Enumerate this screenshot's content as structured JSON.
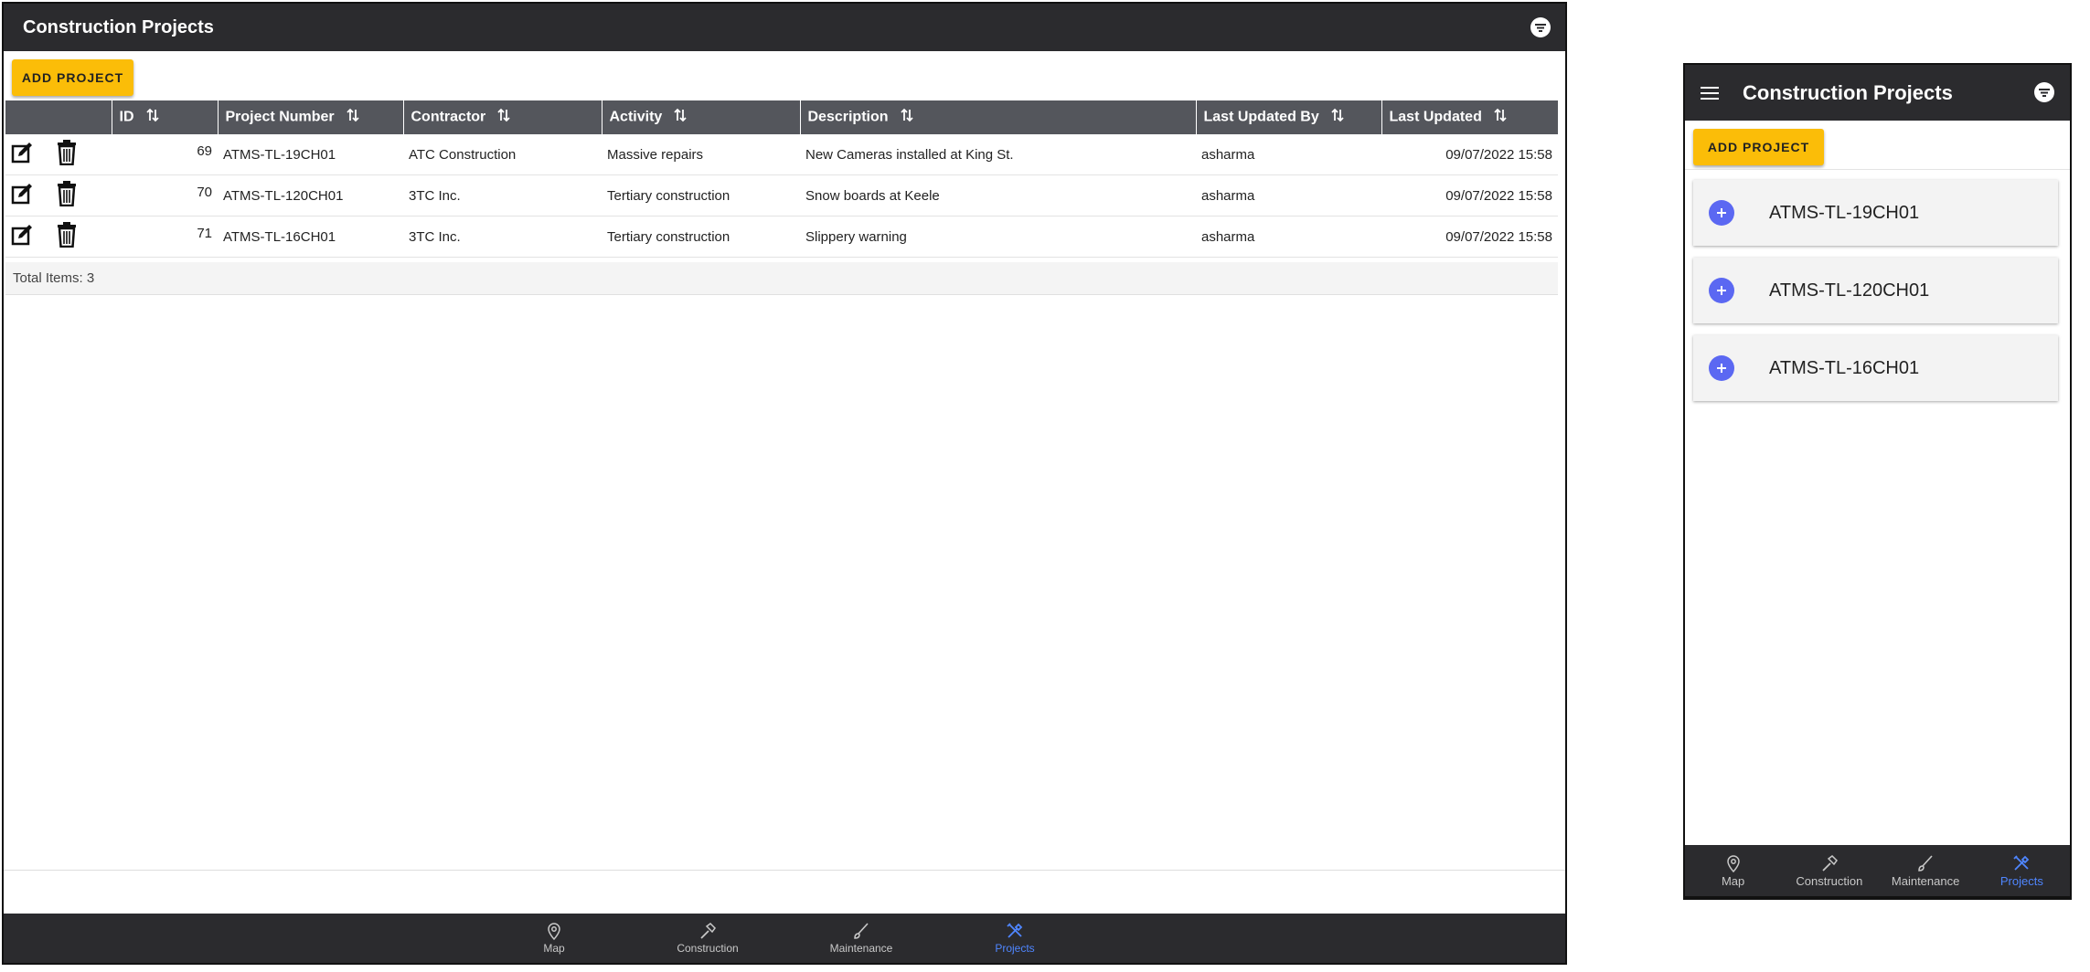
{
  "desktop": {
    "title": "Construction Projects",
    "add_button": "ADD PROJECT",
    "columns": [
      "ID",
      "Project Number",
      "Contractor",
      "Activity",
      "Description",
      "Last Updated By",
      "Last Updated"
    ],
    "rows": [
      {
        "id": "69",
        "project_number": "ATMS-TL-19CH01",
        "contractor": "ATC Construction",
        "activity": "Massive repairs",
        "description": "New Cameras installed at King St.",
        "updated_by": "asharma",
        "updated": "09/07/2022 15:58"
      },
      {
        "id": "70",
        "project_number": "ATMS-TL-120CH01",
        "contractor": "3TC Inc.",
        "activity": "Tertiary construction",
        "description": "Snow boards at Keele",
        "updated_by": "asharma",
        "updated": "09/07/2022 15:58"
      },
      {
        "id": "71",
        "project_number": "ATMS-TL-16CH01",
        "contractor": "3TC Inc.",
        "activity": "Tertiary construction",
        "description": "Slippery warning",
        "updated_by": "asharma",
        "updated": "09/07/2022 15:58"
      }
    ],
    "total_items": "Total Items: 3"
  },
  "nav": {
    "items": [
      {
        "label": "Map",
        "icon": "map-pin-icon"
      },
      {
        "label": "Construction",
        "icon": "hammer-icon"
      },
      {
        "label": "Maintenance",
        "icon": "brush-icon"
      },
      {
        "label": "Projects",
        "icon": "tools-icon"
      }
    ],
    "active": "Projects",
    "active_color": "#4f86ff"
  },
  "mobile": {
    "title": "Construction Projects",
    "add_button": "ADD PROJECT",
    "cards": [
      "ATMS-TL-19CH01",
      "ATMS-TL-120CH01",
      "ATMS-TL-16CH01"
    ]
  },
  "colors": {
    "header_bg": "#2b2b2e",
    "table_header_bg": "#54565c",
    "button_yellow": "#fbbd08",
    "plus_blue": "#5b68f2"
  }
}
